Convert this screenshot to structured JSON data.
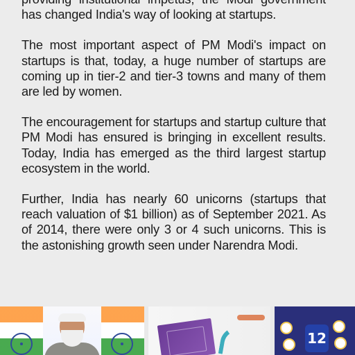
{
  "article": {
    "paragraphs": [
      "providing institutional impetus, the Modi government has changed India's way of looking at startups.",
      "The most important aspect of PM Modi's impact on startups is that, today, a huge number of startups are coming up in tier-2 and tier-3 towns and many of them are led by women.",
      "The encouragement for startups and startup culture that PM Modi has ensured is bringing in excellent results. Today, India has emerged as the third largest startup ecosystem in the world.",
      "Further, India has nearly 60 unicorns (startups that reach valuation of $1 billion) as of September 2021. As of 2014, there were only 3 or 4 such unicorns. This is the astonishing growth seen under Narendra Modi."
    ]
  },
  "thumbnails": {
    "t3_number": "12"
  },
  "colors": {
    "background": "#e9e9e9",
    "text": "#1b1b1b",
    "flag_saffron": "#ff9a3b",
    "flag_green": "#36a23c",
    "chakra_blue": "#2f4b99",
    "poster_purple": "#6b3b96",
    "poster_teal": "#2aa6b8",
    "infographic_navy": "#2a2f7a",
    "infographic_yellow": "#f1c84f"
  }
}
